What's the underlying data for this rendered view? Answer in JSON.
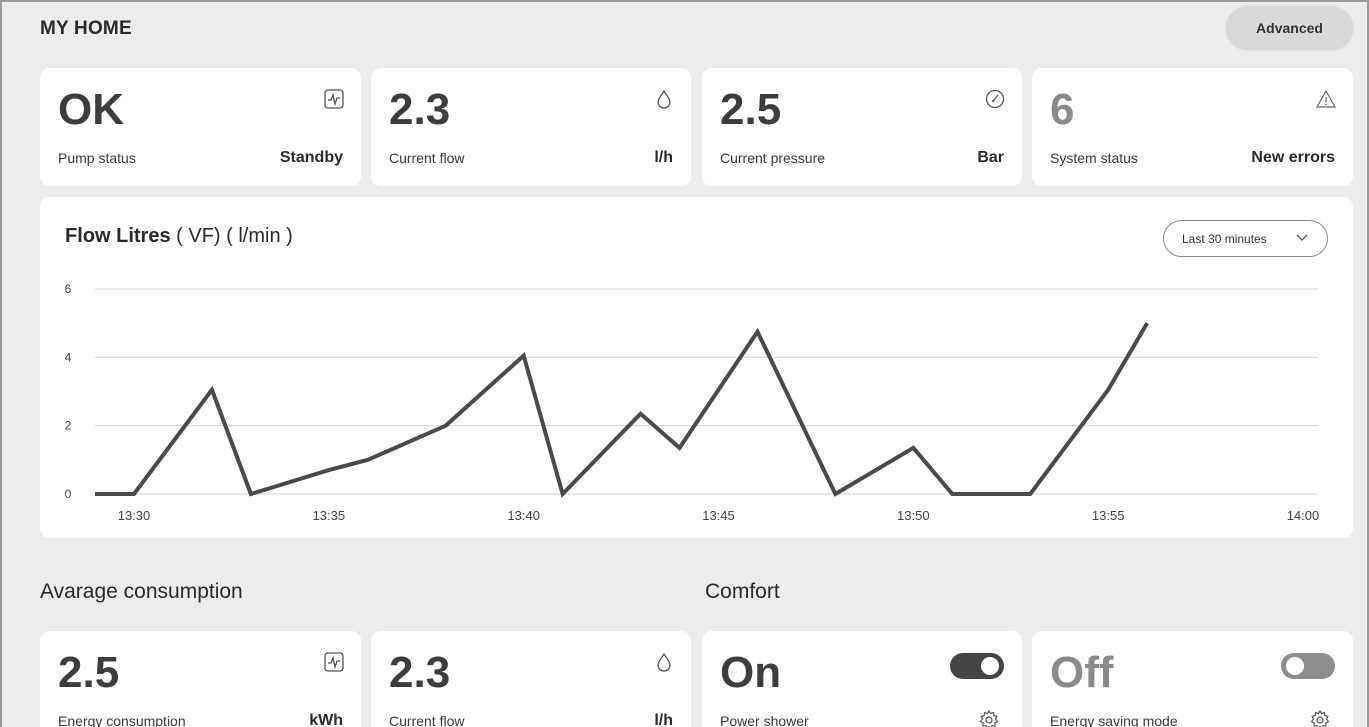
{
  "header": {
    "title": "MY HOME",
    "advanced_label": "Advanced"
  },
  "stats": [
    {
      "value": "OK",
      "label": "Pump status",
      "unit": "Standby",
      "icon": "pulse-icon"
    },
    {
      "value": "2.3",
      "label": "Current flow",
      "unit": "l/h",
      "icon": "droplet-icon"
    },
    {
      "value": "2.5",
      "label": "Current pressure",
      "unit": "Bar",
      "icon": "gauge-icon"
    },
    {
      "value": "6",
      "label": "System status",
      "unit": "New errors",
      "icon": "warning-icon"
    }
  ],
  "chart": {
    "title_bold": "Flow Litres",
    "title_rest": " ( VF) ( l/min )",
    "range_label": "Last 30 minutes"
  },
  "chart_data": {
    "type": "line",
    "title": "Flow Litres ( VF) ( l/min )",
    "xlabel": "",
    "ylabel": "",
    "x_ticks": [
      "13:30",
      "13:35",
      "13:40",
      "13:45",
      "13:50",
      "13:55",
      "14:00"
    ],
    "y_ticks": [
      0,
      2,
      4,
      6
    ],
    "ylim": [
      0,
      6
    ],
    "xlim_minutes": [
      13.5,
      14.0
    ],
    "grid": true,
    "legend": "none",
    "series": [
      {
        "x": [
          "13:29",
          "13:30",
          "13:32",
          "13:33",
          "13:35",
          "13:36",
          "13:38",
          "13:40",
          "13:41",
          "13:43",
          "13:44",
          "13:46",
          "13:48",
          "13:50",
          "13:51",
          "13:53",
          "13:55",
          "13:56"
        ],
        "values": [
          0,
          0,
          3.05,
          0,
          0.7,
          1.0,
          2.0,
          4.05,
          0,
          2.35,
          1.35,
          4.75,
          0,
          1.35,
          0,
          0,
          3.05,
          5.0
        ]
      }
    ],
    "color": "#4a4a4a"
  },
  "sections": {
    "consumption_title": "Avarage consumption",
    "comfort_title": "Comfort"
  },
  "consumption": [
    {
      "value": "2.5",
      "label": "Energy consumption",
      "unit": "kWh",
      "icon": "pulse-icon"
    },
    {
      "value": "2.3",
      "label": "Current flow",
      "unit": "l/h",
      "icon": "droplet-icon"
    }
  ],
  "comfort": [
    {
      "value": "On",
      "label": "Power shower",
      "state": "on"
    },
    {
      "value": "Off",
      "label": "Energy saving mode",
      "state": "off"
    }
  ]
}
